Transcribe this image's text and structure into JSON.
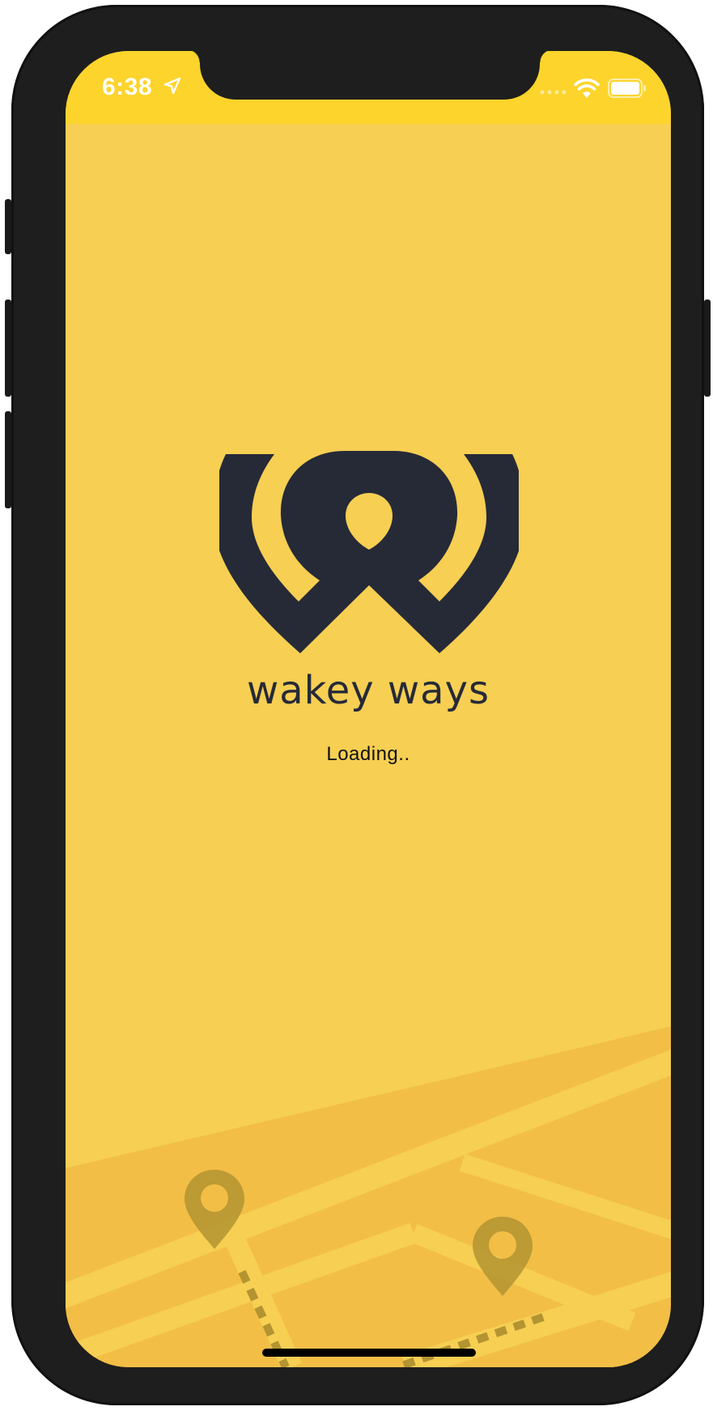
{
  "status_bar": {
    "time": "6:38",
    "icons": [
      "location-arrow-icon",
      "signal-dots-icon",
      "wifi-icon",
      "battery-icon"
    ]
  },
  "splash": {
    "logo_name": "wakey-ways-logo",
    "brand_name": "wakey ways",
    "loading_text": "Loading.."
  },
  "background": {
    "icons": [
      "map-pin-icon",
      "map-pin-icon"
    ]
  },
  "colors": {
    "status_bar": "#fdd42b",
    "screen_background": "#f6cf53",
    "map_blocks": "#f2be46",
    "logo": "#262a37",
    "pins": "#b39431",
    "phone_frame": "#1e1e1e"
  }
}
